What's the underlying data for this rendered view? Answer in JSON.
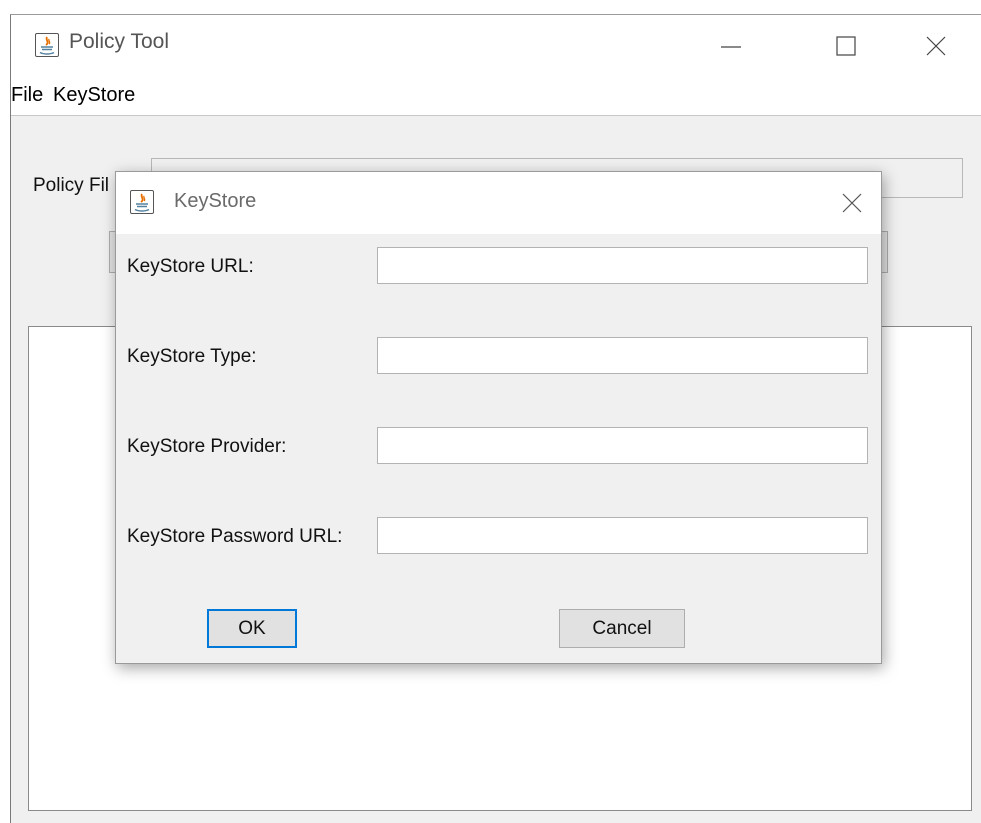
{
  "main_window": {
    "title": "Policy Tool",
    "title_icon": "java-icon",
    "controls": [
      "minimize-icon",
      "maximize-icon",
      "close-icon"
    ],
    "menu": [
      "File",
      "KeyStore"
    ],
    "policy_file_label": "Policy Fil"
  },
  "dialog": {
    "title": "KeyStore",
    "title_icon": "java-icon",
    "close_icon": "close-icon",
    "fields": [
      {
        "label": "KeyStore URL:",
        "value": ""
      },
      {
        "label": "KeyStore Type:",
        "value": ""
      },
      {
        "label": "KeyStore Provider:",
        "value": ""
      },
      {
        "label": "KeyStore Password URL:",
        "value": ""
      }
    ],
    "ok_label": "OK",
    "cancel_label": "Cancel"
  },
  "colors": {
    "window_background": "#f0f0f0",
    "focus_border": "#0078d7",
    "button_face": "#e1e1e1"
  }
}
